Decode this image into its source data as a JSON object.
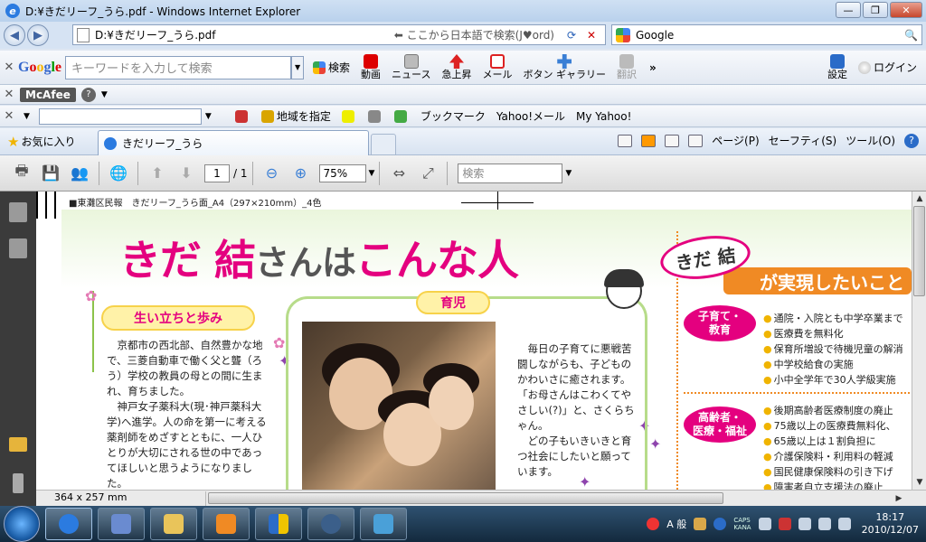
{
  "window": {
    "title": "D:¥きだリーフ_うら.pdf - Windows Internet Explorer"
  },
  "address": {
    "url": "D:¥きだリーフ_うら.pdf",
    "hint": "⬅ ここから日本語で検索(J♥ord)"
  },
  "search_provider": {
    "label": "Google"
  },
  "google_toolbar": {
    "search_placeholder": "キーワードを入力して検索",
    "search_btn": "検索",
    "buttons": [
      "動画",
      "ニュース",
      "急上昇",
      "メール",
      "ボタン ギャラリー"
    ],
    "translate": "翻訳",
    "more": "»",
    "settings": "設定",
    "login": "ログイン"
  },
  "mcafee": {
    "label": "McAfee",
    "help": "?"
  },
  "yahoo_toolbar": {
    "region": "地域を指定",
    "bookmark": "ブックマーク",
    "yahoo_mail": "Yahoo!メール",
    "my_yahoo": "My Yahoo!"
  },
  "favorites": {
    "label": "お気に入り",
    "tab_title": "きだリーフ_うら"
  },
  "command_bar": {
    "page": "ページ(P)",
    "safety": "セーフティ(S)",
    "tools": "ツール(O)",
    "help": "?"
  },
  "pdf_toolbar": {
    "page_current": "1",
    "page_total": "/ 1",
    "zoom": "75%",
    "search_placeholder": "検索"
  },
  "document": {
    "header": "■東灘区民報　きだリーフ_うら面_A4（297×210mm）_4色",
    "headline": {
      "part1": "きだ 結",
      "part2": "さんは",
      "part3": "こんな人"
    },
    "section_birth": "生い立ちと歩み",
    "section_child": "育児",
    "birth_p1": "京都市の西北部、自然豊かな地で、三菱自動車で働く父と聾（ろう）学校の教員の母との間に生まれ、育ちました。",
    "birth_p2": "神戸女子薬科大(現･神戸薬科大学)へ進学。人の命を第一に考える薬剤師をめざすとともに、一人ひとりが大切にされる世の中であってほしいと思うようになりました。",
    "child_p1": "毎日の子育てに悪戦苦闘しながらも、子どものかわいさに癒されます。「お母さんはこわくてやさしい(?)」と、さくらちゃん。",
    "child_p2": "どの子もいきいきと育つ社会にしたいと願っています。",
    "wish_name": "きだ 結",
    "wish_title": "が実現したいこと",
    "cat1": {
      "line1": "子育て・",
      "line2": "教育"
    },
    "cat1_items": [
      "通院・入院とも中学卒業まで",
      "医療費を無料化",
      "保育所増設で待機児童の解消",
      "中学校給食の実施",
      "小中全学年で30人学級実施"
    ],
    "cat2": {
      "line1": "高齢者・",
      "line2": "医療・福祉"
    },
    "cat2_items": [
      "後期高齢者医療制度の廃止",
      "75歳以上の医療費無料化、",
      "65歳以上は１割負担に",
      "介護保険料・利用料の軽減",
      "国民健康保険料の引き下げ",
      "障害者自立支援法の廃止"
    ]
  },
  "status": {
    "page_size": "364 x 257 mm"
  },
  "taskbar": {
    "ime": "A 般",
    "caps": "CAPS",
    "kana": "KANA",
    "time": "18:17",
    "date": "2010/12/07"
  },
  "colors": {
    "accent_pink": "#e4007f",
    "accent_orange": "#f08a24",
    "ie_blue": "#2b7be0"
  }
}
